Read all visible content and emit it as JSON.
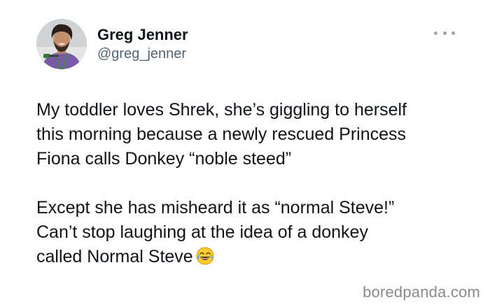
{
  "tweet": {
    "display_name": "Greg Jenner",
    "handle": "@greg_jenner",
    "avatar_icon": "profile-photo",
    "more_icon": "more-options-icon",
    "paragraph_1": "My toddler loves Shrek, she’s giggling to herself\nthis morning because a newly rescued Princess\nFiona calls Donkey “noble steed”",
    "paragraph_2": "Except she has misheard it as “normal Steve!”\nCan’t stop laughing at the idea of a donkey\ncalled Normal Steve",
    "emoji": "face-with-tears-of-joy"
  },
  "watermark": "boredpanda.com"
}
